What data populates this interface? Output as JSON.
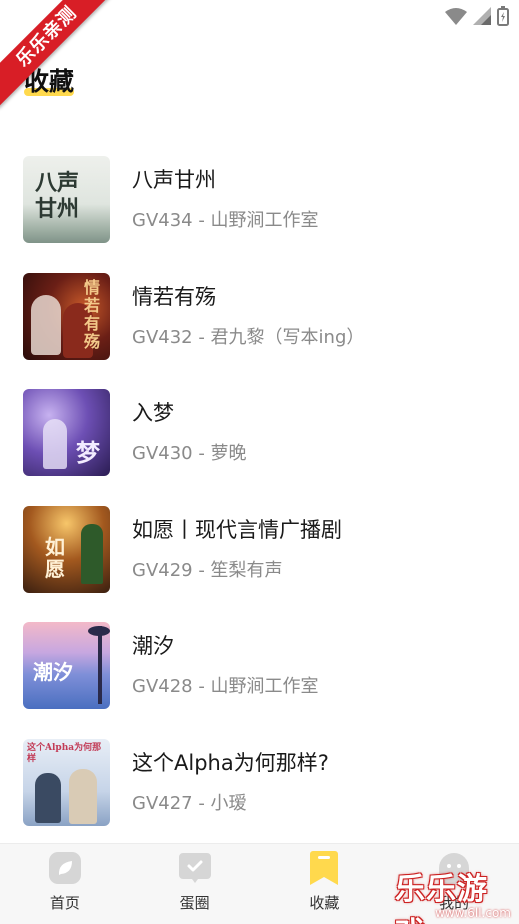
{
  "ribbon": {
    "label": "乐乐亲测"
  },
  "page": {
    "title": "收藏"
  },
  "favorites": [
    {
      "title": "八声甘州",
      "subtitle": "GV434 - 山野涧工作室",
      "cover_text": "八声甘州"
    },
    {
      "title": "情若有殇",
      "subtitle": "GV432 - 君九黎（写本ing）",
      "cover_text": "情若有殇"
    },
    {
      "title": "入梦",
      "subtitle": "GV430 - 萝晚",
      "cover_text": "梦"
    },
    {
      "title": "如愿丨现代言情广播剧",
      "subtitle": "GV429 - 笙梨有声",
      "cover_text": "如愿"
    },
    {
      "title": "潮汐",
      "subtitle": "GV428 - 山野涧工作室",
      "cover_text": "潮汐"
    },
    {
      "title": "这个Alpha为何那样?",
      "subtitle": "GV427 - 小瑷",
      "cover_text": "这个Alpha为何那样"
    }
  ],
  "tabs": [
    {
      "label": "首页",
      "icon": "leaf-icon",
      "active": false
    },
    {
      "label": "蛋圈",
      "icon": "chat-check-icon",
      "active": false
    },
    {
      "label": "收藏",
      "icon": "bookmark-icon",
      "active": true
    },
    {
      "label": "我的",
      "icon": "ghost-icon",
      "active": false
    }
  ],
  "watermark": {
    "text": "乐乐游戏",
    "url": "www.6ll.com"
  },
  "colors": {
    "accent": "#ffd94d",
    "ribbon": "#d81e26",
    "tab_inactive": "#d6d6d6"
  }
}
